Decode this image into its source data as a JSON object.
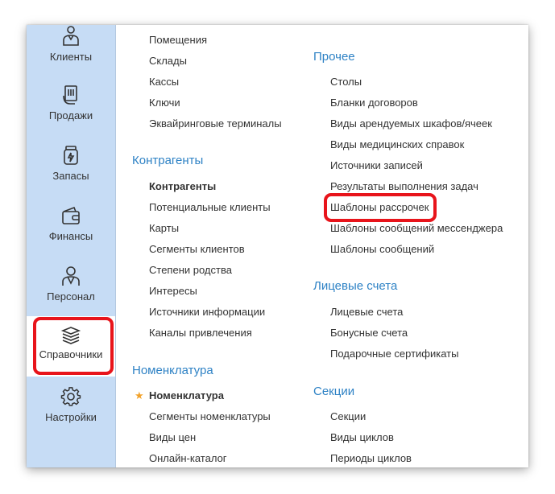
{
  "sidebar": {
    "items": [
      {
        "label": "Клиенты",
        "icon": "client-icon"
      },
      {
        "label": "Продажи",
        "icon": "sales-icon"
      },
      {
        "label": "Запасы",
        "icon": "stock-icon"
      },
      {
        "label": "Финансы",
        "icon": "wallet-icon"
      },
      {
        "label": "Персонал",
        "icon": "staff-icon"
      },
      {
        "label": "Справочники",
        "icon": "books-icon",
        "active": true
      },
      {
        "label": "Настройки",
        "icon": "gear-icon"
      }
    ]
  },
  "left_column": {
    "top_links": [
      "Помещения",
      "Склады",
      "Кассы",
      "Ключи",
      "Эквайринговые терминалы"
    ],
    "contractors": {
      "title": "Контрагенты",
      "links": [
        "Контрагенты",
        "Потенциальные клиенты",
        "Карты",
        "Сегменты клиентов",
        "Степени родства",
        "Интересы",
        "Источники информации",
        "Каналы привлечения"
      ]
    },
    "nomenclature": {
      "title": "Номенклатура",
      "links": [
        "Номенклатура",
        "Сегменты номенклатуры",
        "Виды цен",
        "Онлайн-каталог"
      ]
    }
  },
  "right_column": {
    "other": {
      "title": "Прочее",
      "links": [
        "Столы",
        "Бланки договоров",
        "Виды арендуемых шкафов/ячеек",
        "Виды медицинских справок",
        "Источники записей",
        "Результаты выполнения задач",
        "Шаблоны рассрочек",
        "Шаблоны сообщений мессенджера",
        "Шаблоны сообщений"
      ]
    },
    "accounts": {
      "title": "Лицевые счета",
      "links": [
        "Лицевые счета",
        "Бонусные счета",
        "Подарочные сертификаты"
      ]
    },
    "sections": {
      "title": "Секции",
      "links": [
        "Секции",
        "Виды циклов",
        "Периоды циклов"
      ]
    }
  },
  "colors": {
    "sidebar_bg": "#c6dcf5",
    "section_title": "#2e82c5",
    "highlight": "#e8141b",
    "star": "#f2a22a"
  }
}
